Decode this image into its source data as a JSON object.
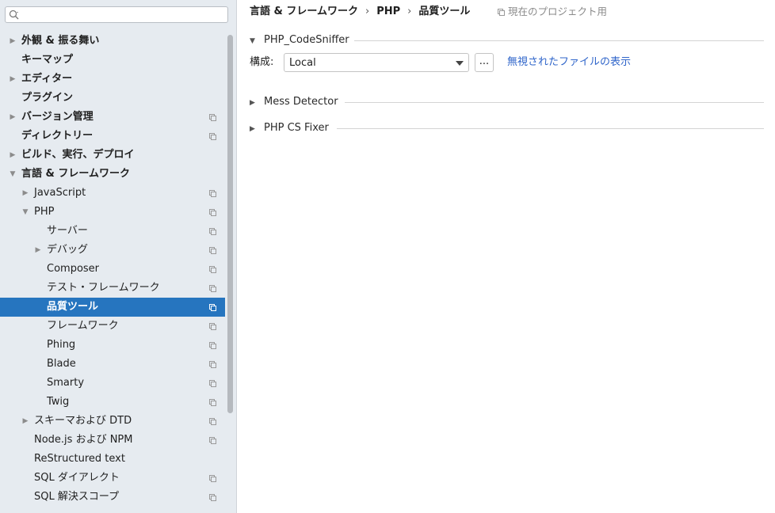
{
  "search": {
    "placeholder": ""
  },
  "sidebar": {
    "items": [
      {
        "label": "外観 & 振る舞い",
        "level": 0,
        "arrow": "▶",
        "bold": true,
        "proj": false,
        "selected": false
      },
      {
        "label": "キーマップ",
        "level": 0,
        "arrow": "",
        "bold": true,
        "proj": false,
        "selected": false
      },
      {
        "label": "エディター",
        "level": 0,
        "arrow": "▶",
        "bold": true,
        "proj": false,
        "selected": false
      },
      {
        "label": "プラグイン",
        "level": 0,
        "arrow": "",
        "bold": true,
        "proj": false,
        "selected": false
      },
      {
        "label": "バージョン管理",
        "level": 0,
        "arrow": "▶",
        "bold": true,
        "proj": true,
        "selected": false
      },
      {
        "label": "ディレクトリー",
        "level": 0,
        "arrow": "",
        "bold": true,
        "proj": true,
        "selected": false
      },
      {
        "label": "ビルド、実行、デプロイ",
        "level": 0,
        "arrow": "▶",
        "bold": true,
        "proj": false,
        "selected": false
      },
      {
        "label": "言語 & フレームワーク",
        "level": 0,
        "arrow": "▼",
        "bold": true,
        "proj": false,
        "selected": false
      },
      {
        "label": "JavaScript",
        "level": 1,
        "arrow": "▶",
        "bold": false,
        "proj": true,
        "selected": false
      },
      {
        "label": "PHP",
        "level": 1,
        "arrow": "▼",
        "bold": false,
        "proj": true,
        "selected": false
      },
      {
        "label": "サーバー",
        "level": 2,
        "arrow": "",
        "bold": false,
        "proj": true,
        "selected": false
      },
      {
        "label": "デバッグ",
        "level": 2,
        "arrow": "▶",
        "bold": false,
        "proj": true,
        "selected": false
      },
      {
        "label": "Composer",
        "level": 2,
        "arrow": "",
        "bold": false,
        "proj": true,
        "selected": false
      },
      {
        "label": "テスト・フレームワーク",
        "level": 2,
        "arrow": "",
        "bold": false,
        "proj": true,
        "selected": false
      },
      {
        "label": "品質ツール",
        "level": 2,
        "arrow": "",
        "bold": true,
        "proj": true,
        "selected": true
      },
      {
        "label": "フレームワーク",
        "level": 2,
        "arrow": "",
        "bold": false,
        "proj": true,
        "selected": false
      },
      {
        "label": "Phing",
        "level": 2,
        "arrow": "",
        "bold": false,
        "proj": true,
        "selected": false
      },
      {
        "label": "Blade",
        "level": 2,
        "arrow": "",
        "bold": false,
        "proj": true,
        "selected": false
      },
      {
        "label": "Smarty",
        "level": 2,
        "arrow": "",
        "bold": false,
        "proj": true,
        "selected": false
      },
      {
        "label": "Twig",
        "level": 2,
        "arrow": "",
        "bold": false,
        "proj": true,
        "selected": false
      },
      {
        "label": "スキーマおよび DTD",
        "level": 1,
        "arrow": "▶",
        "bold": false,
        "proj": true,
        "selected": false
      },
      {
        "label": "Node.js および NPM",
        "level": 1,
        "arrow": "",
        "bold": false,
        "proj": true,
        "selected": false
      },
      {
        "label": "ReStructured text",
        "level": 1,
        "arrow": "",
        "bold": false,
        "proj": false,
        "selected": false
      },
      {
        "label": "SQL ダイアレクト",
        "level": 1,
        "arrow": "",
        "bold": false,
        "proj": true,
        "selected": false
      },
      {
        "label": "SQL 解決スコープ",
        "level": 1,
        "arrow": "",
        "bold": false,
        "proj": true,
        "selected": false
      }
    ]
  },
  "breadcrumb": {
    "items": [
      "言語 & フレームワーク",
      "PHP",
      "品質ツール"
    ],
    "separator": "›"
  },
  "scope_note": "現在のプロジェクト用",
  "sections": [
    {
      "title": "PHP_CodeSniffer",
      "expanded": true
    },
    {
      "title": "Mess Detector",
      "expanded": false
    },
    {
      "title": "PHP CS Fixer",
      "expanded": false
    }
  ],
  "config": {
    "label": "構成:",
    "value": "Local",
    "more_label": "...",
    "ignored_link": "無視されたファイルの表示"
  },
  "colors": {
    "selection": "#2675bf",
    "link": "#2f65ca",
    "sidebar_bg": "#e6ebf0"
  },
  "icons": {
    "search": "search-icon",
    "dropdown": "chevron-down-icon",
    "project_scope": "project-scope-icon"
  }
}
